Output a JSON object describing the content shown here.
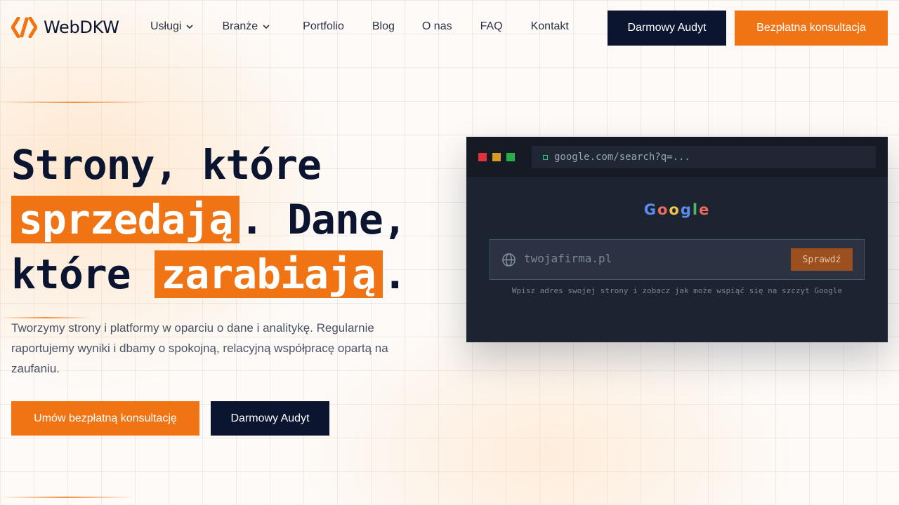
{
  "brand": {
    "name": "WebDKW"
  },
  "nav": {
    "items": [
      {
        "label": "Usługi",
        "has_dropdown": true
      },
      {
        "label": "Branże",
        "has_dropdown": true
      },
      {
        "label": "Portfolio",
        "has_dropdown": false
      },
      {
        "label": "Blog",
        "has_dropdown": false
      },
      {
        "label": "O nas",
        "has_dropdown": false
      },
      {
        "label": "FAQ",
        "has_dropdown": false
      },
      {
        "label": "Kontakt",
        "has_dropdown": false
      }
    ],
    "audit_button": "Darmowy Audyt",
    "consult_button": "Bezpłatna konsultacja"
  },
  "hero": {
    "title_part1": "Strony, które",
    "title_highlight1": "sprzedają",
    "title_part2": ". Dane,",
    "title_part3": "które",
    "title_highlight2": "zarabiają",
    "title_part4": ".",
    "description": "Tworzymy strony i platformy w oparciu o dane i analitykę. Regularnie raportujemy wyniki i dbamy o spokojną, relacyjną współpracę opartą na zaufaniu.",
    "consult_button": "Umów bezpłatną konsultację",
    "audit_button": "Darmowy Audyt"
  },
  "browser_mock": {
    "url": "google.com/search?q=...",
    "logo_letters": [
      "G",
      "o",
      "o",
      "g",
      "l",
      "e"
    ],
    "search_placeholder": "twojafirma.pl",
    "check_button": "Sprawdź",
    "hint": "Wpisz adres swojej strony i zobacz jak może wspiąć się na szczyt Google"
  },
  "colors": {
    "accent": "#f07414",
    "navy": "#0b1530",
    "window_dots": [
      "#e0303a",
      "#d99a1e",
      "#22b04b"
    ],
    "google_letters": [
      "#5b8def",
      "#ee6a5e",
      "#f3c44c",
      "#5b8def",
      "#4cb86a",
      "#ee6a5e"
    ]
  },
  "icons": {
    "logo": "webdkw-logo-icon",
    "dropdown": "chevron-down-icon",
    "secure": "lock-icon",
    "globe": "globe-icon"
  }
}
